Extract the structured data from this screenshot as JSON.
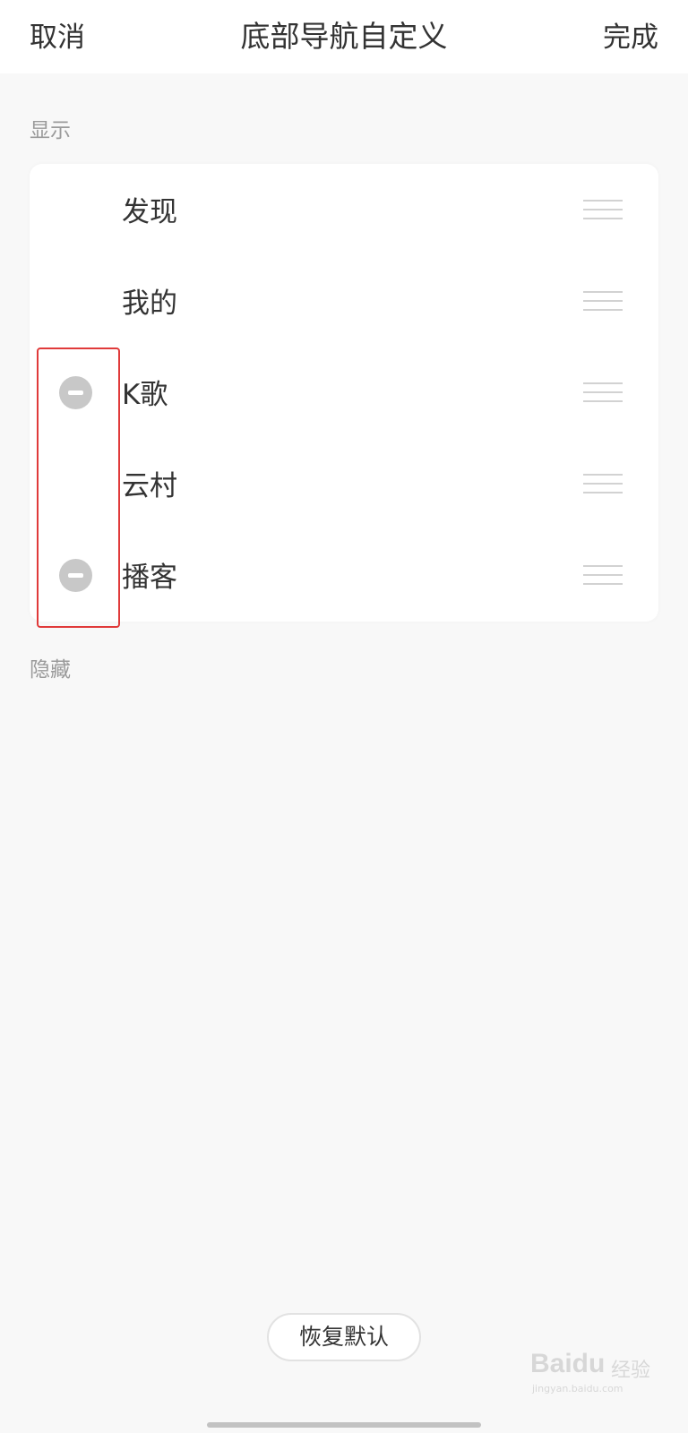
{
  "header": {
    "cancel_label": "取消",
    "title": "底部导航自定义",
    "done_label": "完成"
  },
  "sections": {
    "shown_label": "显示",
    "hidden_label": "隐藏"
  },
  "shown_items": [
    {
      "label": "发现",
      "removable": false
    },
    {
      "label": "我的",
      "removable": false
    },
    {
      "label": "K歌",
      "removable": true
    },
    {
      "label": "云村",
      "removable": false
    },
    {
      "label": "播客",
      "removable": true
    }
  ],
  "footer": {
    "restore_label": "恢复默认"
  },
  "watermark": {
    "brand": "Baidu",
    "brand_sub": "经验",
    "domain": "jingyan.baidu.com"
  },
  "icons": {
    "remove": "minus-circle-icon",
    "drag": "drag-handle-icon"
  },
  "colors": {
    "background": "#f8f8f8",
    "card": "#ffffff",
    "text": "#333333",
    "section_label": "#9a9a9a",
    "remove_icon": "#c8c8c8",
    "highlight": "#e03a3a"
  }
}
